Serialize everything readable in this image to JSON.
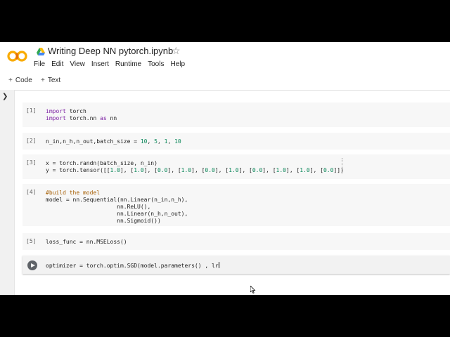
{
  "header": {
    "title": "Writing Deep NN pytorch.ipynb",
    "logo_text": "CO",
    "menu": [
      "File",
      "Edit",
      "View",
      "Insert",
      "Runtime",
      "Tools",
      "Help"
    ]
  },
  "toolbar": {
    "code_label": "Code",
    "text_label": "Text"
  },
  "cells": [
    {
      "exec": "[1]",
      "lines": [
        "import torch",
        "import torch.nn as nn"
      ]
    },
    {
      "exec": "[2]",
      "lines": [
        "n_in,n_h,n_out,batch_size = 10, 5, 1, 10"
      ]
    },
    {
      "exec": "[3]",
      "lines": [
        "x = torch.randn(batch_size, n_in)",
        "y = torch.tensor([[1.0], [1.0], [0.0], [1.0], [0.0], [1.0], [0.0], [1.0], [1.0], [0.0]])"
      ]
    },
    {
      "exec": "[4]",
      "lines": [
        "#build the model",
        "model = nn.Sequential(nn.Linear(n_in,n_h),",
        "                     nn.ReLU(),",
        "                     nn.Linear(n_h,n_out),",
        "                     nn.Sigmoid())"
      ]
    },
    {
      "exec": "[5]",
      "lines": [
        "loss_func = nn.MSELoss()"
      ]
    },
    {
      "exec": "",
      "lines": [
        "optimizer = torch.optim.SGD(model.parameters() , lr"
      ]
    }
  ],
  "colors": {
    "logo_orange": "#f9ab00",
    "keyword": "#7b1fa2",
    "number": "#098658",
    "comment": "#a55d00"
  },
  "icons": [
    "colab-logo",
    "drive-icon",
    "star-icon",
    "plus-icon",
    "chevron-right-icon",
    "run-cell-icon",
    "mouse-pointer-icon"
  ]
}
